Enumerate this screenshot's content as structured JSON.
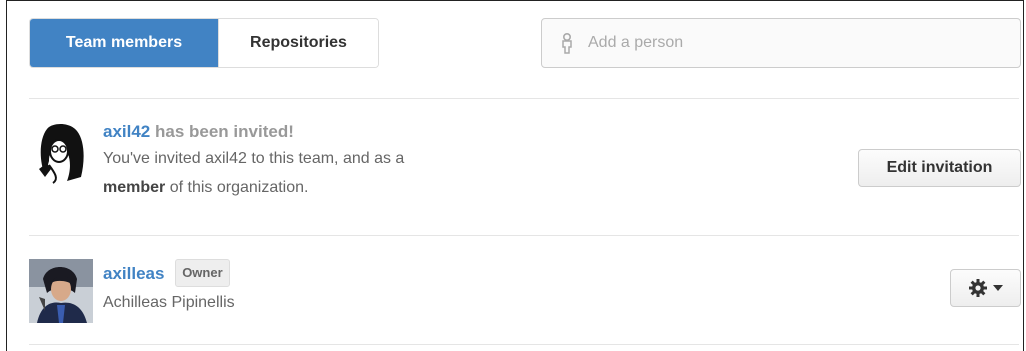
{
  "tabs": [
    {
      "label": "Team members",
      "active": true
    },
    {
      "label": "Repositories",
      "active": false
    }
  ],
  "search": {
    "placeholder": "Add a person",
    "icon": "person-icon"
  },
  "invited": {
    "username": "axil42",
    "status_text": "has been invited!",
    "line2": "You've invited axil42 to this team, and as a",
    "role": "member",
    "line3_suffix": "of this organization.",
    "button_label": "Edit invitation"
  },
  "member": {
    "username": "axilleas",
    "badge": "Owner",
    "full_name": "Achilleas Pipinellis",
    "settings_icon": "gear-icon",
    "dropdown_icon": "caret-down-icon"
  },
  "colors": {
    "accent": "#4183c4",
    "text": "#333333",
    "muted": "#999999"
  }
}
